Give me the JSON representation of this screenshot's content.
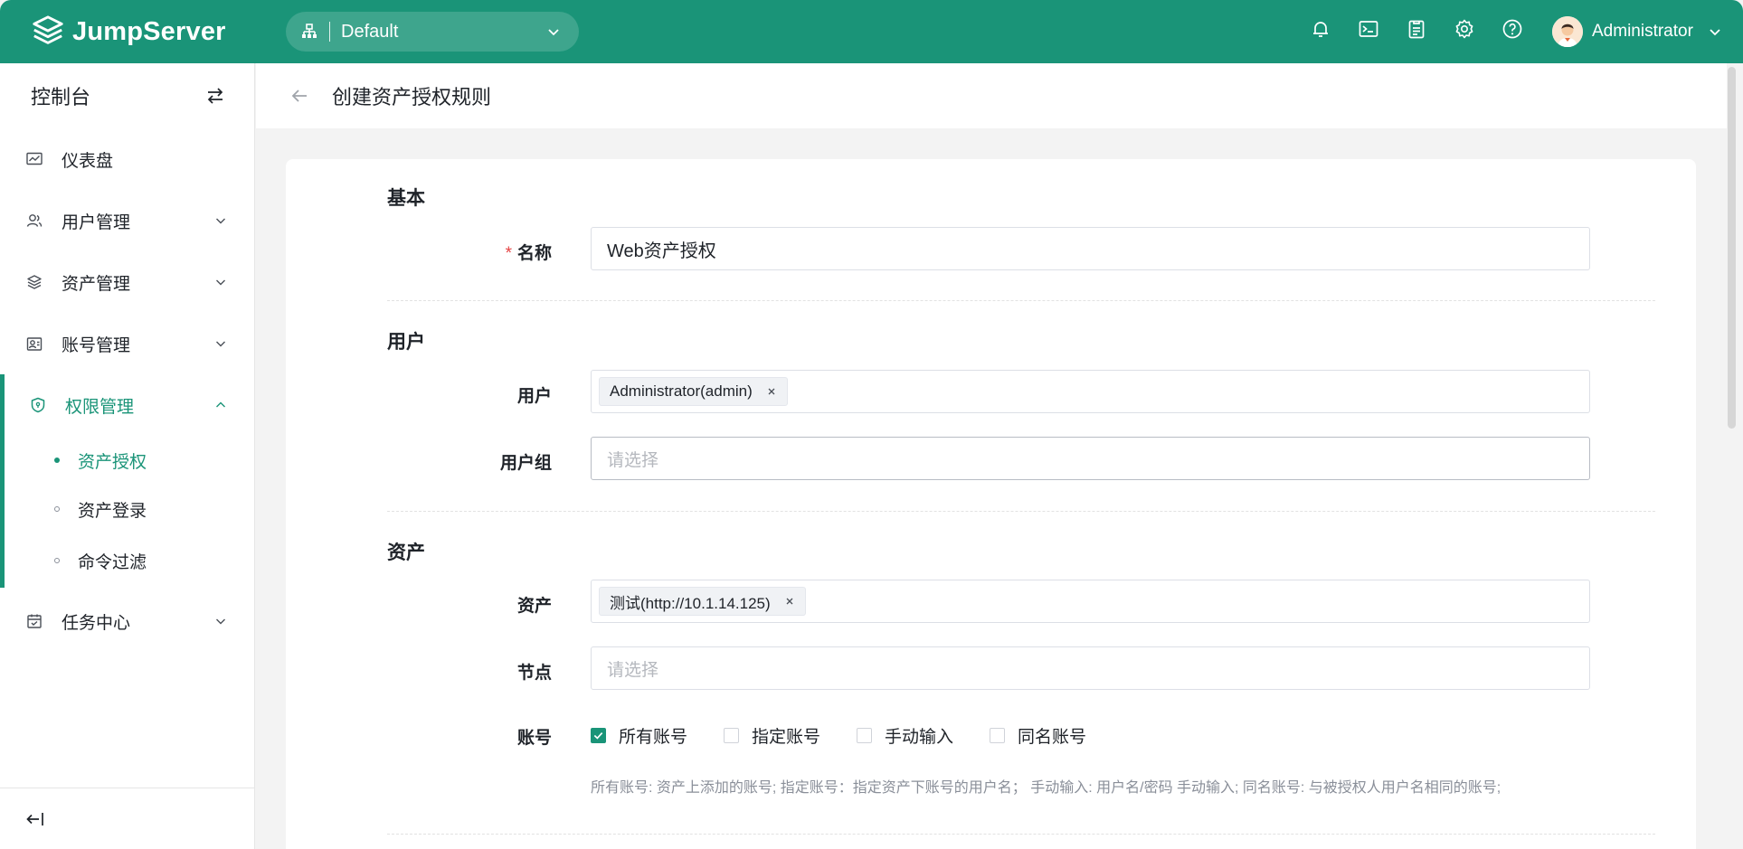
{
  "app": {
    "brand": "JumpServer"
  },
  "topbar": {
    "org": "Default",
    "icons": [
      "bell-icon",
      "terminal-icon",
      "clipboard-icon",
      "gear-icon",
      "help-icon"
    ],
    "user": "Administrator"
  },
  "sidebar": {
    "title": "控制台",
    "items": [
      {
        "label": "仪表盘",
        "icon": "dashboard-icon"
      },
      {
        "label": "用户管理",
        "icon": "users-icon"
      },
      {
        "label": "资产管理",
        "icon": "layers-icon"
      },
      {
        "label": "账号管理",
        "icon": "account-icon"
      },
      {
        "label": "权限管理",
        "icon": "shield-icon"
      },
      {
        "label": "任务中心",
        "icon": "calendar-icon"
      }
    ],
    "subitems": [
      {
        "label": "资产授权",
        "active": true
      },
      {
        "label": "资产登录",
        "active": false
      },
      {
        "label": "命令过滤",
        "active": false
      }
    ]
  },
  "page": {
    "title": "创建资产授权规则"
  },
  "form": {
    "sections": {
      "basic": "基本",
      "user": "用户",
      "asset": "资产"
    },
    "name": {
      "label": "名称",
      "required_mark": "*",
      "value": "Web资产授权"
    },
    "users": {
      "label": "用户",
      "tags": [
        "Administrator(admin)"
      ]
    },
    "user_groups": {
      "label": "用户组",
      "placeholder": "请选择"
    },
    "assets": {
      "label": "资产",
      "tags": [
        "测试(http://10.1.14.125)"
      ]
    },
    "nodes": {
      "label": "节点",
      "placeholder": "请选择"
    },
    "accounts": {
      "label": "账号",
      "options": [
        {
          "label": "所有账号",
          "checked": true
        },
        {
          "label": "指定账号",
          "checked": false
        },
        {
          "label": "手动输入",
          "checked": false
        },
        {
          "label": "同名账号",
          "checked": false
        }
      ],
      "help": "所有账号: 资产上添加的账号; 指定账号：指定资产下账号的用户名； 手动输入: 用户名/密码 手动输入; 同名账号: 与被授权人用户名相同的账号;"
    }
  },
  "colors": {
    "brand": "#1a9478",
    "required": "#e54545"
  }
}
